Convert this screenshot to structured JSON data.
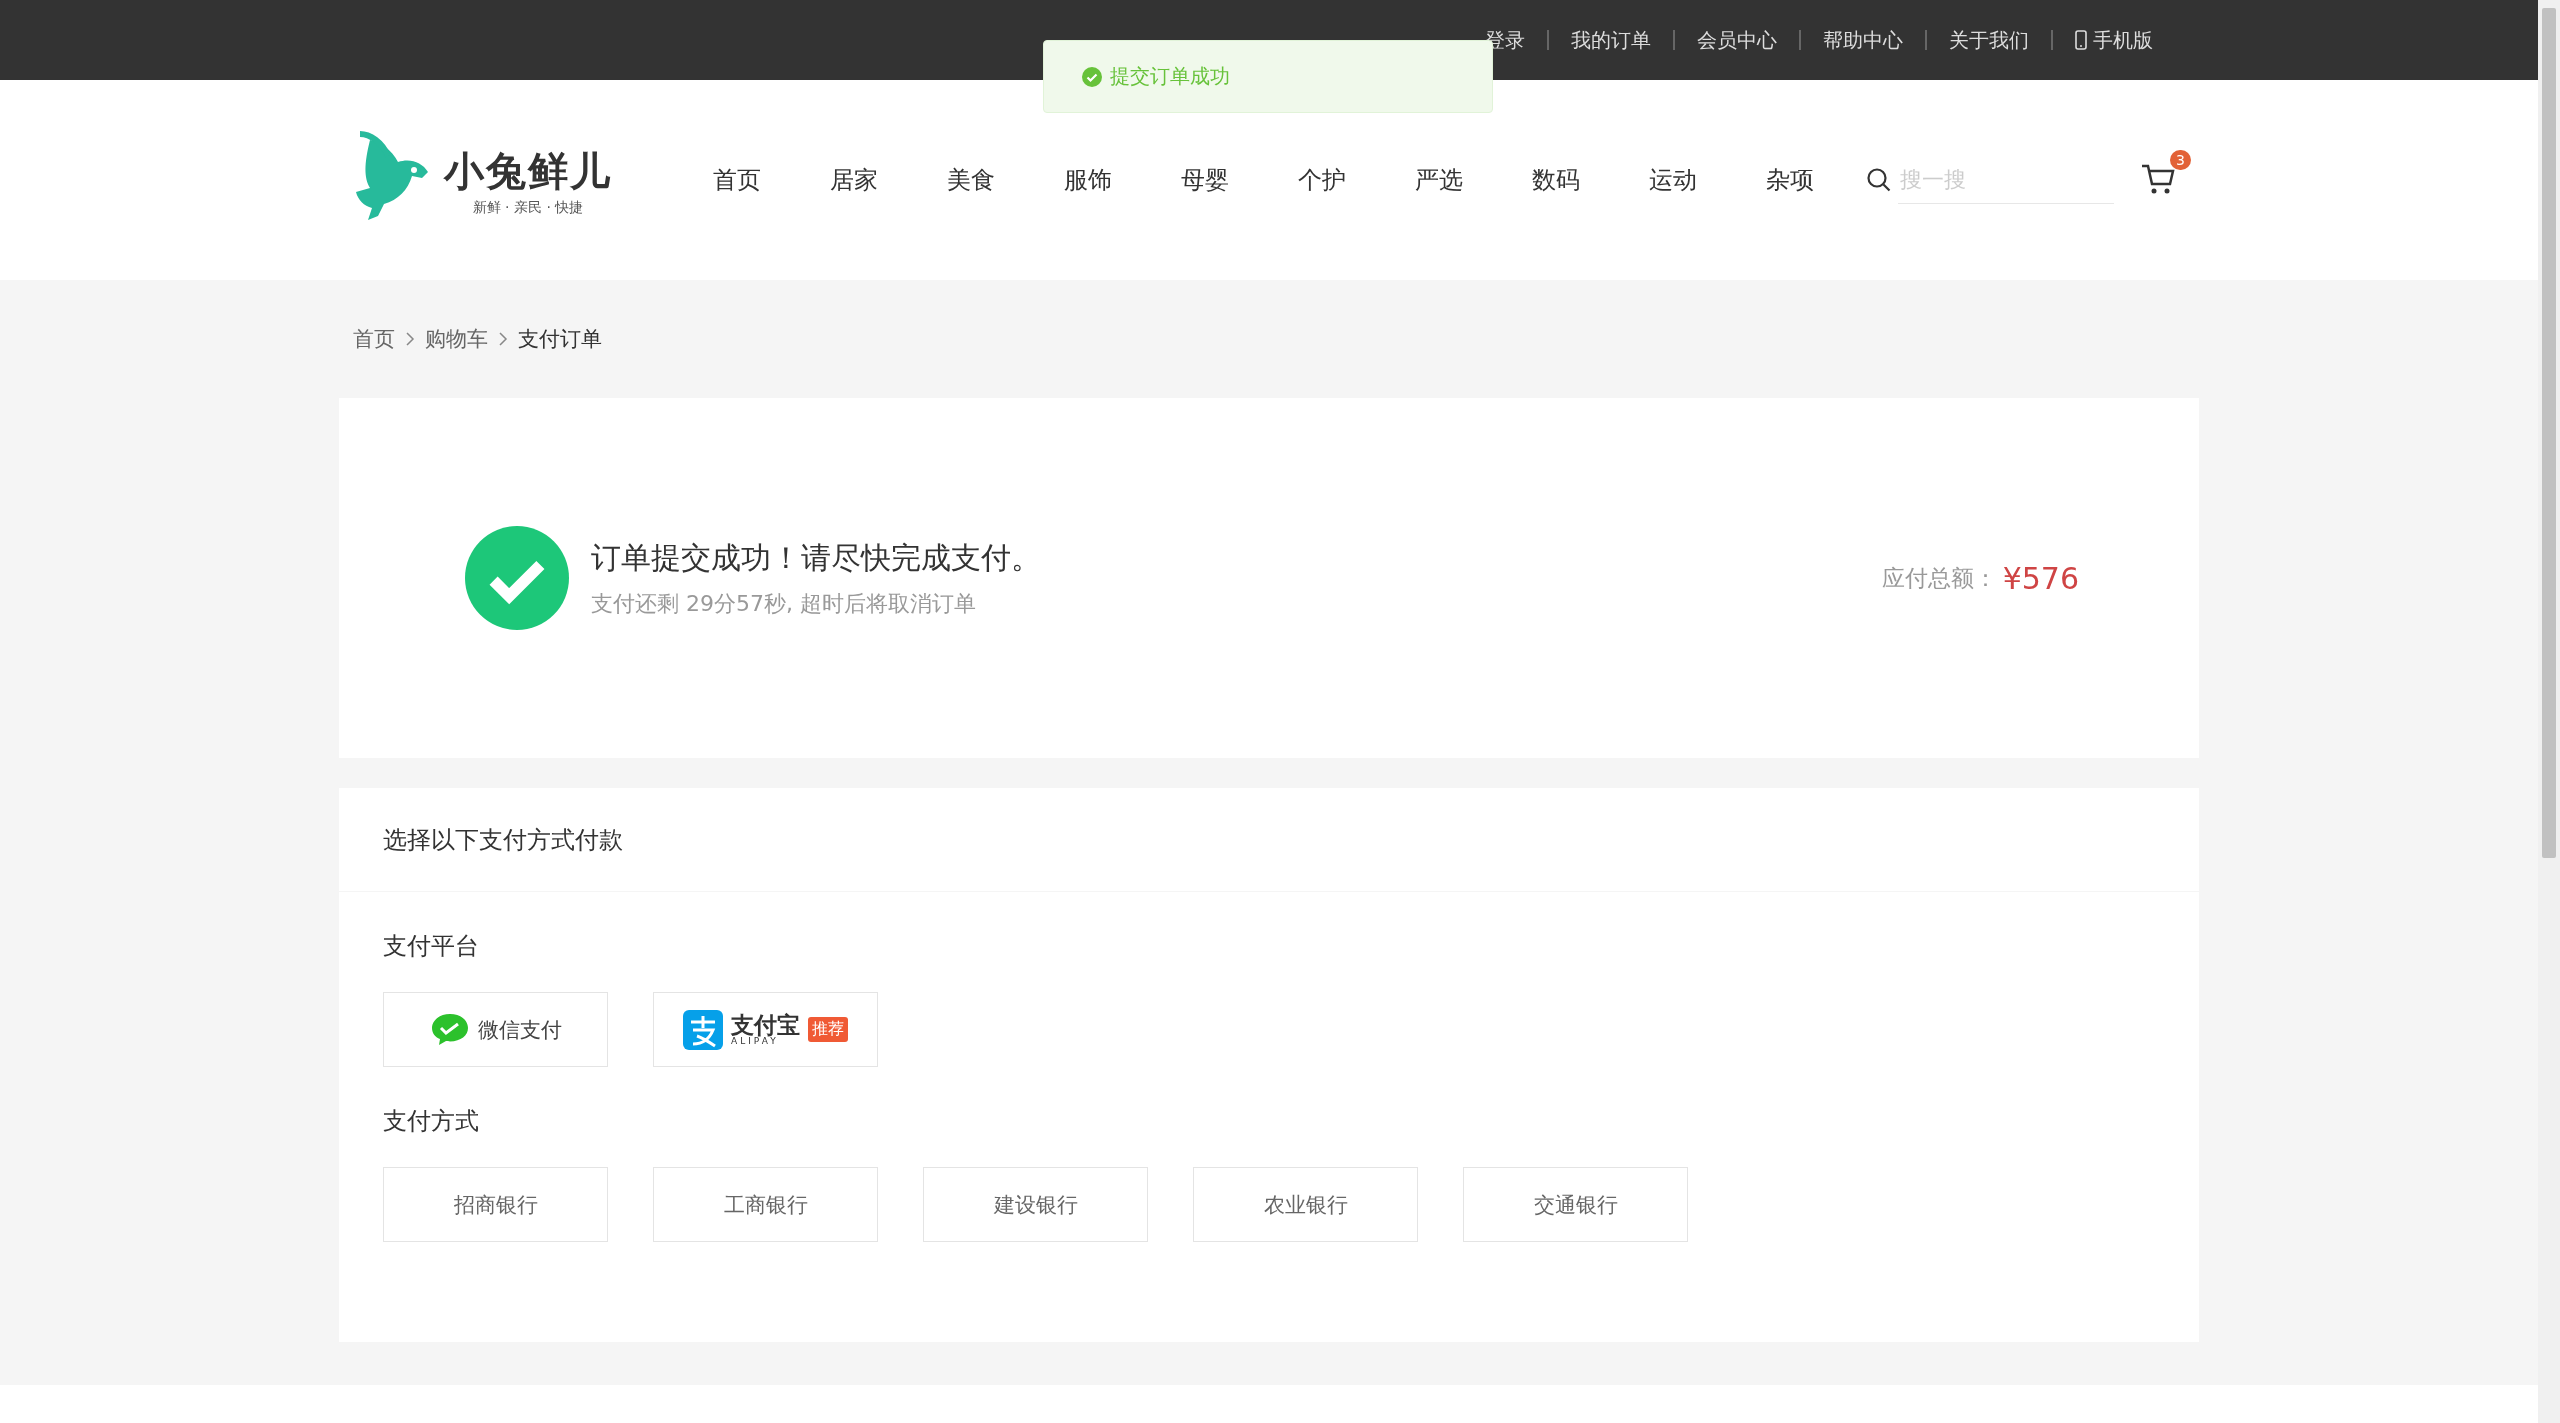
{
  "top_bar": {
    "links": [
      "登录",
      "我的订单",
      "会员中心",
      "帮助中心",
      "关于我们"
    ],
    "mobile": "手机版"
  },
  "toast": {
    "text": "提交订单成功"
  },
  "logo": {
    "name": "小兔鲜儿",
    "slogan": "新鲜 · 亲民 · 快捷"
  },
  "nav": [
    "首页",
    "居家",
    "美食",
    "服饰",
    "母婴",
    "个护",
    "严选",
    "数码",
    "运动",
    "杂项"
  ],
  "search": {
    "placeholder": "搜一搜"
  },
  "cart": {
    "count": "3"
  },
  "breadcrumb": [
    "首页",
    "购物车",
    "支付订单"
  ],
  "order": {
    "title": "订单提交成功！请尽快完成支付。",
    "subtitle": "支付还剩 29分57秒, 超时后将取消订单",
    "total_label": "应付总额：",
    "total": "¥576"
  },
  "payment": {
    "title": "选择以下支付方式付款",
    "platform_title": "支付平台",
    "platforms": [
      {
        "kind": "wechat",
        "name": "微信支付"
      },
      {
        "kind": "alipay",
        "name": "支付宝",
        "sub": "ALIPAY",
        "badge": "推荐"
      }
    ],
    "method_title": "支付方式",
    "banks": [
      "招商银行",
      "工商银行",
      "建设银行",
      "农业银行",
      "交通银行"
    ]
  }
}
